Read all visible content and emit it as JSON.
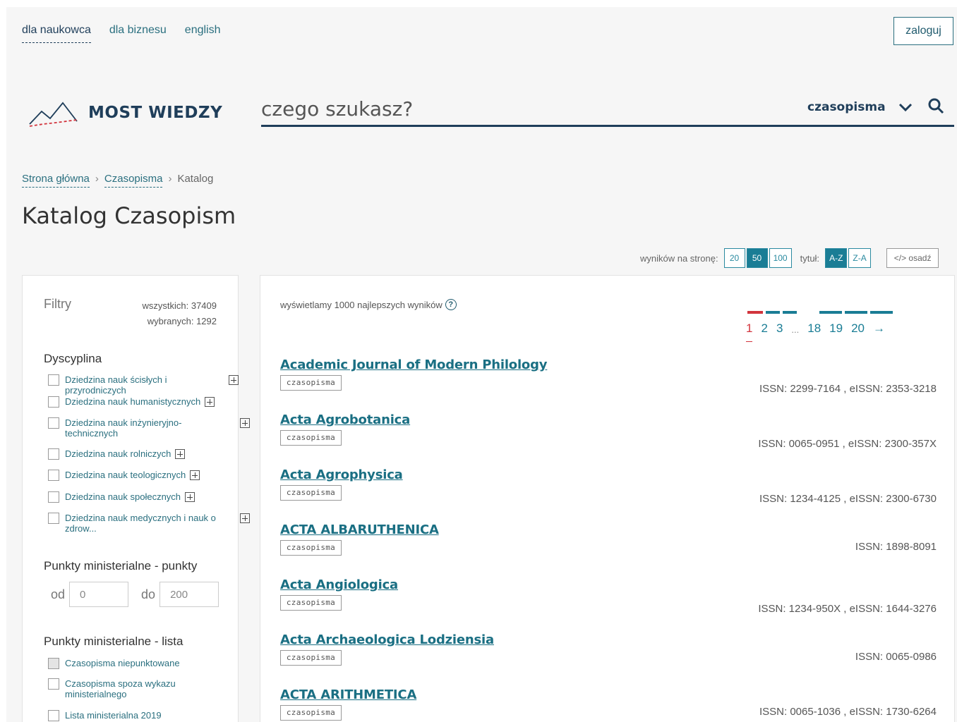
{
  "nav": {
    "links": [
      "dla naukowca",
      "dla biznesu",
      "english"
    ],
    "login": "zaloguj"
  },
  "logo": {
    "text": "MOST WIEDZY"
  },
  "search": {
    "placeholder": "czego szukasz?",
    "category": "czasopisma"
  },
  "breadcrumb": [
    "Strona główna",
    "Czasopisma",
    "Katalog"
  ],
  "title": "Katalog Czasopism",
  "controls": {
    "per_page_label": "wyników na stronę:",
    "per_page": [
      "20",
      "50",
      "100"
    ],
    "per_page_active": "50",
    "sort_label": "tytuł:",
    "sort": [
      "A-Z",
      "Z-A"
    ],
    "sort_active": "A-Z",
    "embed": "</> osadź"
  },
  "filters": {
    "title": "Filtry",
    "all": "wszystkich: 37409",
    "selected": "wybranych: 1292",
    "discipline_title": "Dyscyplina",
    "disciplines": [
      "Dziedzina nauk ścisłych i przyrodniczych",
      "Dziedzina nauk humanistycznych",
      "Dziedzina nauk inżynieryjno-technicznych",
      "Dziedzina nauk rolniczych",
      "Dziedzina nauk teologicznych",
      "Dziedzina nauk społecznych",
      "Dziedzina nauk medycznych i nauk o zdrow..."
    ],
    "points_title": "Punkty ministerialne - punkty",
    "from_label": "od",
    "from_value": "0",
    "to_label": "do",
    "to_value": "200",
    "list_title": "Punkty ministerialne - lista",
    "lists": [
      "Czasopisma niepunktowane",
      "Czasopisma spoza wykazu ministerialnego",
      "Lista ministerialna 2019"
    ]
  },
  "results": {
    "info": "wyświetlamy 1000 najlepszych wyników",
    "pages": [
      "1",
      "2",
      "3",
      "...",
      "18",
      "19",
      "20",
      "→"
    ],
    "items": [
      {
        "title": "Academic Journal of Modern Philology",
        "tag": "czasopisma",
        "issn": "ISSN: 2299-7164 , eISSN: 2353-3218"
      },
      {
        "title": "Acta Agrobotanica",
        "tag": "czasopisma",
        "issn": "ISSN: 0065-0951 , eISSN: 2300-357X"
      },
      {
        "title": "Acta Agrophysica",
        "tag": "czasopisma",
        "issn": "ISSN: 1234-4125 , eISSN: 2300-6730"
      },
      {
        "title": "ACTA ALBARUTHENICA",
        "tag": "czasopisma",
        "issn": "ISSN: 1898-8091"
      },
      {
        "title": "Acta Angiologica",
        "tag": "czasopisma",
        "issn": "ISSN: 1234-950X , eISSN: 1644-3276"
      },
      {
        "title": "Acta Archaeologica Lodziensia",
        "tag": "czasopisma",
        "issn": "ISSN: 0065-0986"
      },
      {
        "title": "ACTA ARITHMETICA",
        "tag": "czasopisma",
        "issn": "ISSN: 0065-1036 , eISSN: 1730-6264"
      }
    ]
  },
  "colors": {
    "primary": "#1f3e5a",
    "accent": "#1a7d95",
    "active_page": "#d2343d"
  },
  "icons": [
    "mountain-logo-icon",
    "chevron-down-icon",
    "search-icon",
    "help-icon",
    "plus-expand-icon",
    "arrow-right-icon"
  ]
}
